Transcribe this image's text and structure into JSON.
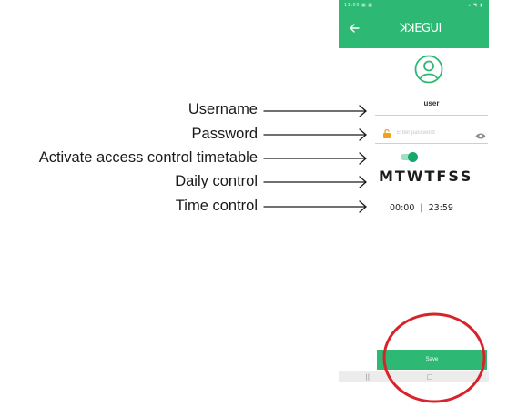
{
  "annotations": {
    "username": "Username",
    "password": "Password",
    "activate_timetable": "Activate access control timetable",
    "daily_control": "Daily control",
    "time_control": "Time control"
  },
  "phone": {
    "status_left": "11:03 ▣ ▦",
    "status_right": "◂ ◥ ▮",
    "app_bar": {
      "back_icon": "arrow-left-icon",
      "brand": "ꓘꓘEGUI",
      "color": "#2db874"
    },
    "avatar_icon": "user-circle-icon",
    "username_value": "user",
    "password": {
      "icon": "lock-icon",
      "placeholder": "Enter password",
      "visibility_icon": "eye-icon"
    },
    "timetable_toggle": {
      "on": true,
      "color": "#14a86a"
    },
    "days": [
      "M",
      "T",
      "W",
      "T",
      "F",
      "S",
      "S"
    ],
    "time_from": "00:00",
    "time_separator": "|",
    "time_to": "23:59",
    "save_label": "Save",
    "nav": [
      "|||",
      "□",
      "‹"
    ]
  },
  "highlight": {
    "target": "save-button",
    "color": "#d8232a"
  }
}
